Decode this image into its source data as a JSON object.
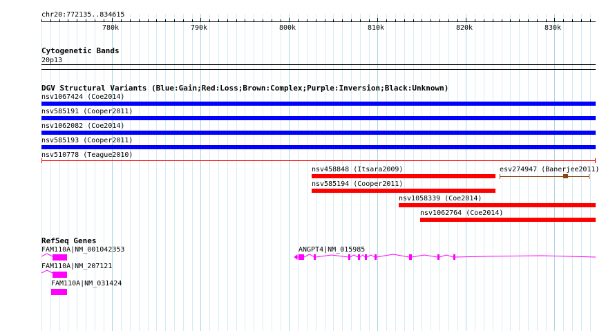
{
  "ruler": {
    "location": "chr20:772135..834615",
    "ticks": [
      "780k",
      "790k",
      "800k",
      "810k",
      "820k",
      "830k"
    ]
  },
  "cytobands": {
    "title": "Cytogenetic Bands",
    "band": "20p13"
  },
  "dgv": {
    "title": "DGV Structural Variants (Blue:Gain;Red:Loss;Brown:Complex;Purple:Inversion;Black:Unknown)",
    "colors": {
      "gain": "#0000ff",
      "loss": "#ff0000",
      "complex": "#8b4513"
    },
    "items": [
      {
        "label": "nsv1067424 (Coe2014)",
        "type": "gain"
      },
      {
        "label": "nsv585191 (Cooper2011)",
        "type": "gain"
      },
      {
        "label": "nsv1062082 (Coe2014)",
        "type": "gain"
      },
      {
        "label": "nsv585193 (Cooper2011)",
        "type": "gain"
      },
      {
        "label": "nsv510778 (Teague2010)",
        "type": "loss"
      },
      {
        "label": "nsv458848 (Itsara2009)",
        "type": "loss"
      },
      {
        "label": "esv274947 (Banerjee2011)",
        "type": "complex"
      },
      {
        "label": "nsv585194 (Cooper2011)",
        "type": "loss"
      },
      {
        "label": "nsv1058339 (Coe2014)",
        "type": "loss"
      },
      {
        "label": "nsv1062764 (Coe2014)",
        "type": "loss"
      }
    ]
  },
  "refseq": {
    "title": "RefSeq Genes",
    "color": "#ff00ff",
    "genes": [
      {
        "label": "FAM110A|NM_001042353"
      },
      {
        "label": "FAM110A|NM_207121"
      },
      {
        "label": "FAM110A|NM_031424"
      },
      {
        "label": "ANGPT4|NM_015985"
      }
    ]
  }
}
